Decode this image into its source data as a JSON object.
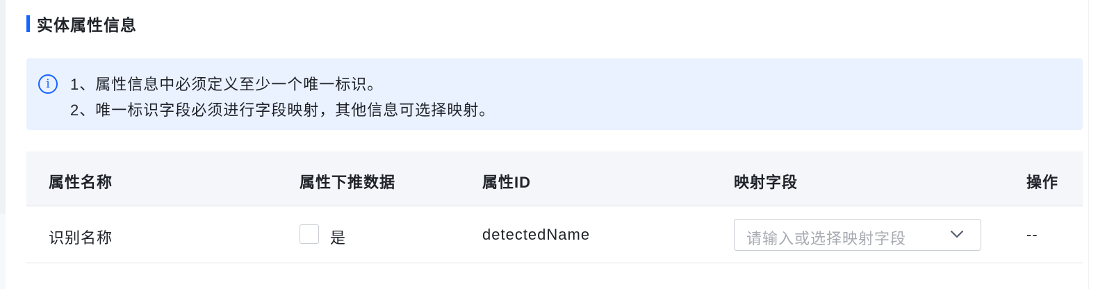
{
  "section": {
    "title": "实体属性信息"
  },
  "notice": {
    "icon": "info-circle-icon",
    "lines": [
      "1、属性信息中必须定义至少一个唯一标识。",
      "2、唯一标识字段必须进行字段映射，其他信息可选择映射。"
    ]
  },
  "table": {
    "columns": [
      "属性名称",
      "属性下推数据",
      "属性ID",
      "映射字段",
      "操作"
    ],
    "rows": [
      {
        "name": "识别名称",
        "push_checkbox_label": "是",
        "push_checked": false,
        "attr_id": "detectedName",
        "mapping_placeholder": "请输入或选择映射字段",
        "mapping_icon": "chevron-down-icon",
        "operation": "--"
      }
    ]
  },
  "colors": {
    "accent": "#1664ff",
    "notice_bg": "#eaf1ff",
    "header_bg": "#f5f6fa",
    "border": "#dde0e6",
    "placeholder": "#a8abb2"
  }
}
